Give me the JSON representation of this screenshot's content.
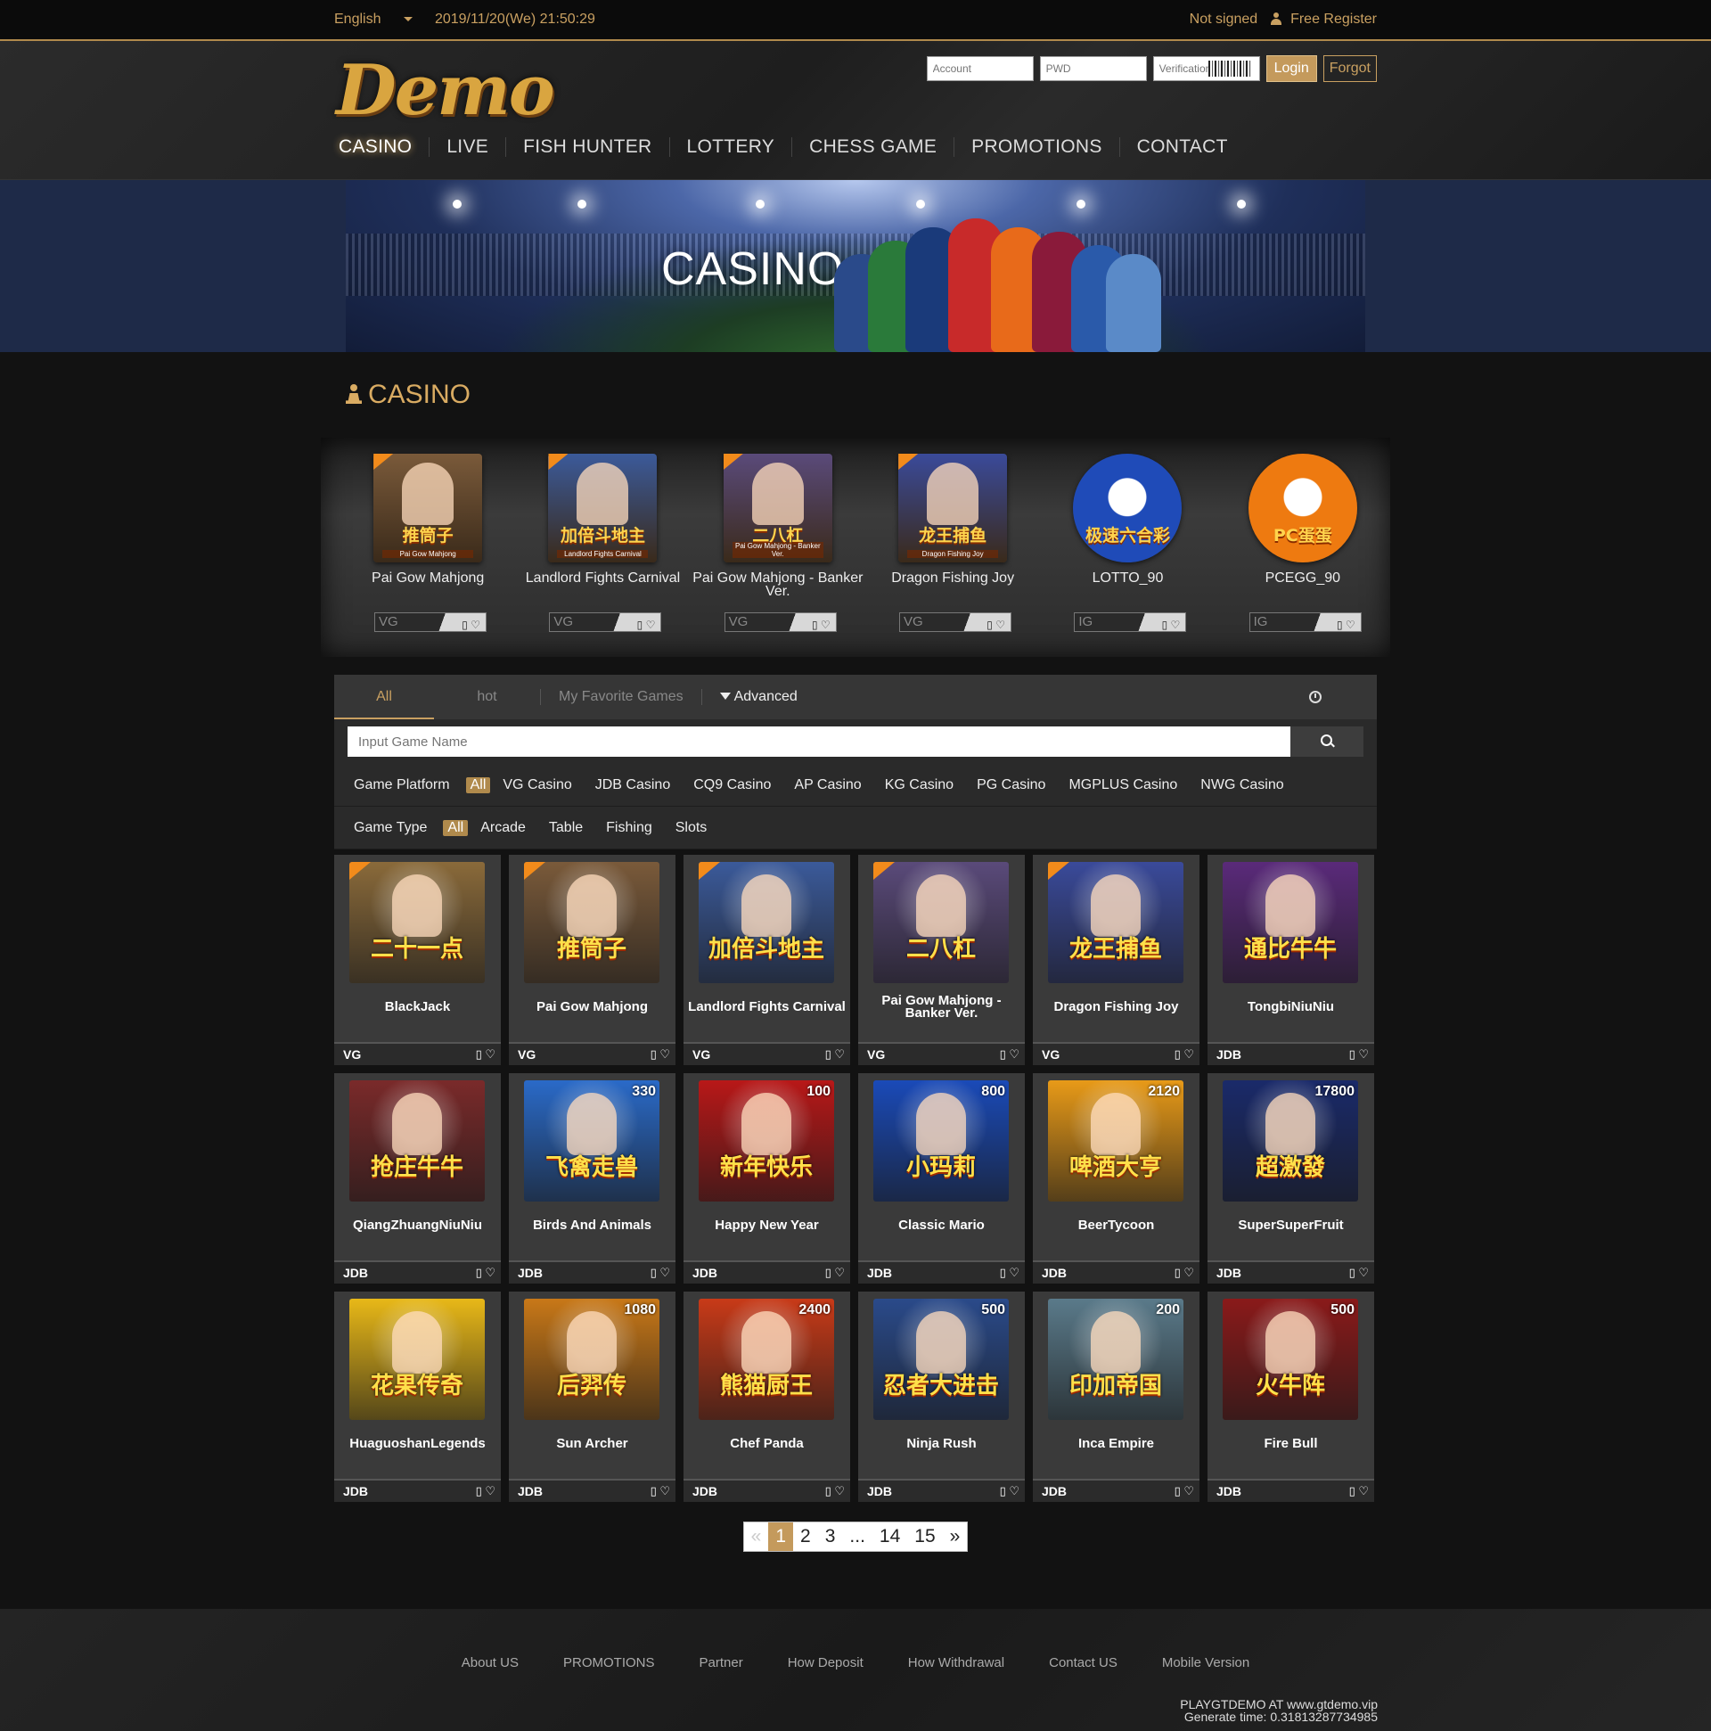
{
  "topbar": {
    "language": "English",
    "datetime": "2019/11/20(We) 21:50:29",
    "status": "Not signed",
    "register": "Free Register"
  },
  "header": {
    "logo": "Demo",
    "account_placeholder": "Account",
    "pwd_placeholder": "PWD",
    "verify_placeholder": "Verification",
    "login_label": "Login",
    "forgot_label": "Forgot"
  },
  "nav": [
    "CASINO",
    "LIVE",
    "FISH HUNTER",
    "LOTTERY",
    "CHESS GAME",
    "PROMOTIONS",
    "CONTACT"
  ],
  "banner": {
    "title": "CASINO"
  },
  "section": {
    "title": "CASINO"
  },
  "featured": [
    {
      "name": "Pai Gow Mahjong",
      "provider": "VG",
      "cn": "推筒子",
      "sub": "Pai Gow Mahjong",
      "bg": "#7a5a3a",
      "round": false
    },
    {
      "name": "Landlord Fights Carnival",
      "provider": "VG",
      "cn": "加倍斗地主",
      "sub": "Landlord Fights Carnival",
      "bg": "#3b5a9a",
      "round": false
    },
    {
      "name": "Pai Gow Mahjong - Banker Ver.",
      "provider": "VG",
      "cn": "二八杠",
      "sub": "Pai Gow Mahjong - Banker Ver.",
      "bg": "#5a4a7a",
      "round": false
    },
    {
      "name": "Dragon Fishing Joy",
      "provider": "VG",
      "cn": "龙王捕鱼",
      "sub": "Dragon Fishing Joy",
      "bg": "#3a4a9a",
      "round": false
    },
    {
      "name": "LOTTO_90",
      "provider": "IG",
      "cn": "极速六合彩",
      "sub": "",
      "bg": "#1f4bb8",
      "round": true
    },
    {
      "name": "PCEGG_90",
      "provider": "IG",
      "cn": "PC蛋蛋",
      "sub": "",
      "bg": "#ee7a10",
      "round": true
    }
  ],
  "tabs": {
    "all": "All",
    "hot": "hot",
    "favorites": "My Favorite Games",
    "advanced": "Advanced"
  },
  "search": {
    "placeholder": "Input Game Name"
  },
  "platform": {
    "label": "Game Platform",
    "options": [
      "All",
      "VG Casino",
      "JDB Casino",
      "CQ9 Casino",
      "AP Casino",
      "KG Casino",
      "PG Casino",
      "MGPLUS Casino",
      "NWG Casino"
    ]
  },
  "gametype": {
    "label": "Game Type",
    "options": [
      "All",
      "Arcade",
      "Table",
      "Fishing",
      "Slots"
    ]
  },
  "games": [
    {
      "name": "BlackJack",
      "provider": "VG",
      "cn": "二十一点",
      "num": "",
      "bg": "#8a6a3a",
      "badge": true
    },
    {
      "name": "Pai Gow Mahjong",
      "provider": "VG",
      "cn": "推筒子",
      "num": "",
      "bg": "#7a5a3a",
      "badge": true
    },
    {
      "name": "Landlord Fights Carnival",
      "provider": "VG",
      "cn": "加倍斗地主",
      "num": "",
      "bg": "#3b5a9a",
      "badge": true
    },
    {
      "name": "Pai Gow Mahjong - Banker Ver.",
      "provider": "VG",
      "cn": "二八杠",
      "num": "",
      "bg": "#5a4a7a",
      "badge": true
    },
    {
      "name": "Dragon Fishing Joy",
      "provider": "VG",
      "cn": "龙王捕鱼",
      "num": "",
      "bg": "#3a4a9a",
      "badge": true
    },
    {
      "name": "TongbiNiuNiu",
      "provider": "JDB",
      "cn": "通比牛牛",
      "num": "",
      "bg": "#5a2a7a",
      "badge": false
    },
    {
      "name": "QiangZhuangNiuNiu",
      "provider": "JDB",
      "cn": "抢庄牛牛",
      "num": "",
      "bg": "#7a2a2a",
      "badge": false
    },
    {
      "name": "Birds And Animals",
      "provider": "JDB",
      "cn": "飞禽走兽",
      "num": "330",
      "bg": "#2a6ac8",
      "badge": false
    },
    {
      "name": "Happy New Year",
      "provider": "JDB",
      "cn": "新年快乐",
      "num": "100",
      "bg": "#b81818",
      "badge": false
    },
    {
      "name": "Classic Mario",
      "provider": "JDB",
      "cn": "小玛莉",
      "num": "800",
      "bg": "#1a4ab8",
      "badge": false
    },
    {
      "name": "BeerTycoon",
      "provider": "JDB",
      "cn": "啤酒大亨",
      "num": "2120",
      "bg": "#e89a18",
      "badge": false
    },
    {
      "name": "SuperSuperFruit",
      "provider": "JDB",
      "cn": "超激發",
      "num": "17800",
      "bg": "#1a2a6a",
      "badge": false
    },
    {
      "name": "HuaguoshanLegends",
      "provider": "JDB",
      "cn": "花果传奇",
      "num": "",
      "bg": "#e8b818",
      "badge": false
    },
    {
      "name": "Sun Archer",
      "provider": "JDB",
      "cn": "后羿传",
      "num": "1080",
      "bg": "#c87818",
      "badge": false
    },
    {
      "name": "Chef Panda",
      "provider": "JDB",
      "cn": "熊猫厨王",
      "num": "2400",
      "bg": "#c83a18",
      "badge": false
    },
    {
      "name": "Ninja Rush",
      "provider": "JDB",
      "cn": "忍者大进击",
      "num": "500",
      "bg": "#2a4a8a",
      "badge": false
    },
    {
      "name": "Inca Empire",
      "provider": "JDB",
      "cn": "印加帝国",
      "num": "200",
      "bg": "#5a7a8a",
      "badge": false
    },
    {
      "name": "Fire Bull",
      "provider": "JDB",
      "cn": "火牛阵",
      "num": "500",
      "bg": "#8a1a1a",
      "badge": false
    }
  ],
  "pagination": [
    "«",
    "1",
    "2",
    "3",
    "...",
    "14",
    "15",
    "»"
  ],
  "footer": {
    "links": [
      "About US",
      "PROMOTIONS",
      "Partner",
      "How Deposit",
      "How Withdrawal",
      "Contact US",
      "Mobile Version"
    ],
    "brand": "PLAYGTDEMO AT www.gtdemo.vip",
    "generate": "Generate time: 0.31813287734985"
  },
  "colors": {
    "accent": "#c9a061",
    "button": "#c49a5c"
  }
}
